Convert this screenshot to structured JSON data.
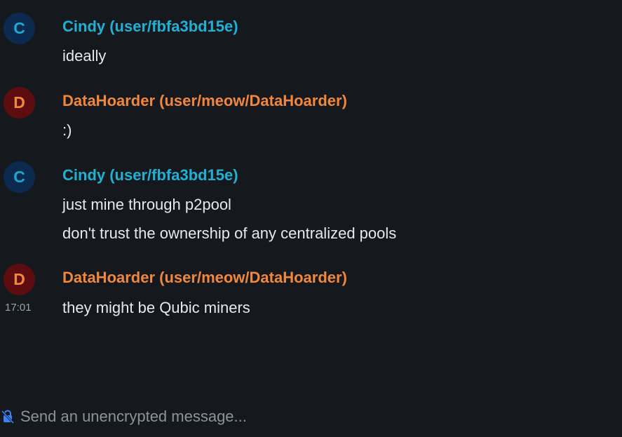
{
  "messages": [
    {
      "avatar_letter": "C",
      "sender": "Cindy (user/fbfa3bd15e)",
      "lines": [
        "ideally"
      ]
    },
    {
      "avatar_letter": "D",
      "sender": "DataHoarder (user/meow/DataHoarder)",
      "lines": [
        ":)"
      ]
    },
    {
      "avatar_letter": "C",
      "sender": "Cindy (user/fbfa3bd15e)",
      "lines": [
        "just mine through p2pool",
        "don't trust the ownership of any centralized pools"
      ]
    },
    {
      "avatar_letter": "D",
      "sender": "DataHoarder (user/meow/DataHoarder)",
      "timestamp": "17:01",
      "lines": [
        "they might be Qubic miners"
      ]
    }
  ],
  "composer": {
    "placeholder": "Send an unencrypted message...",
    "value": "",
    "icon": "unencrypted-lock-icon",
    "icon_color": "#3b82f6"
  },
  "colors": {
    "background": "#15191e",
    "cindy_name": "#1eb1d4",
    "datahoarder_name": "#f0873d"
  }
}
